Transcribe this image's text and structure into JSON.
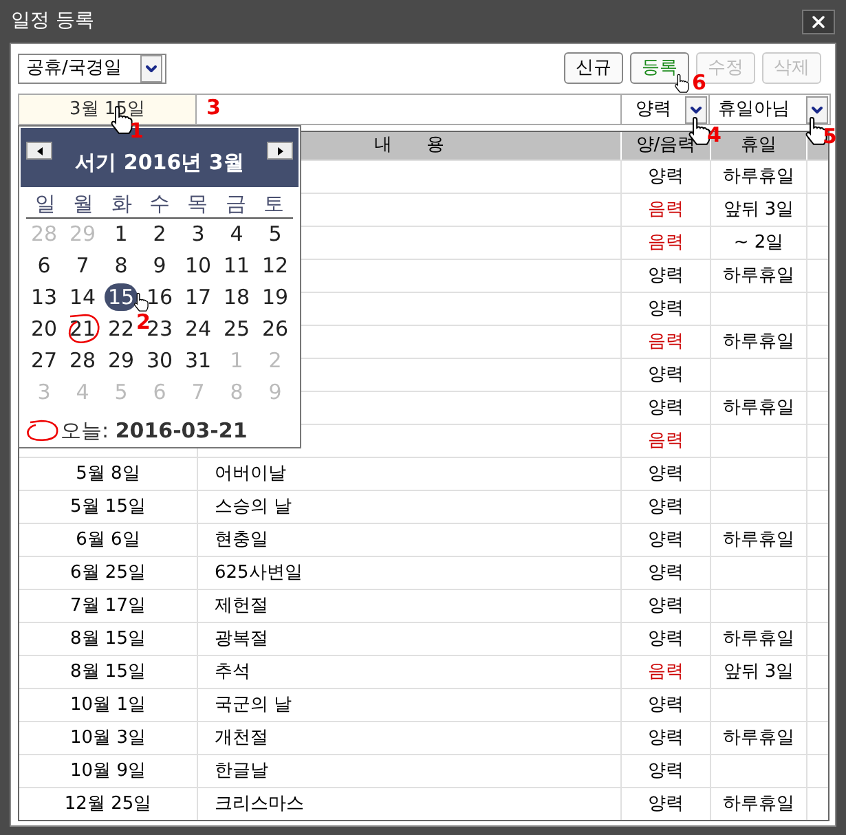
{
  "window": {
    "title": "일정 등록"
  },
  "toolbar": {
    "category": "공휴/국경일",
    "buttons": [
      {
        "label": "신규",
        "disabled": false,
        "highlighted": false
      },
      {
        "label": "등록",
        "disabled": false,
        "highlighted": true
      },
      {
        "label": "수정",
        "disabled": true,
        "highlighted": false
      },
      {
        "label": "삭제",
        "disabled": true,
        "highlighted": false
      }
    ]
  },
  "form": {
    "date": "3월 15일",
    "calendar_type": "양력",
    "holiday": "휴일아님"
  },
  "table": {
    "columns": [
      "내      용",
      "양/음력",
      "휴일"
    ],
    "rows": [
      {
        "calendar": "양력",
        "lunar": false,
        "holiday": "하루휴일"
      },
      {
        "calendar": "음력",
        "lunar": true,
        "holiday": "앞뒤 3일"
      },
      {
        "calendar": "음력",
        "lunar": true,
        "holiday": "~ 2일"
      },
      {
        "calendar": "양력",
        "lunar": false,
        "holiday": "하루휴일"
      },
      {
        "calendar": "양력",
        "lunar": false
      },
      {
        "calendar": "음력",
        "lunar": true,
        "holiday": "하루휴일"
      },
      {
        "calendar": "양력",
        "lunar": false
      },
      {
        "calendar": "양력",
        "lunar": false,
        "holiday": "하루휴일"
      },
      {
        "calendar": "음력",
        "lunar": true
      },
      {
        "date": "5월 8일",
        "name": "어버이날",
        "calendar": "양력",
        "lunar": false
      },
      {
        "date": "5월 15일",
        "name": "스승의 날",
        "calendar": "양력",
        "lunar": false
      },
      {
        "date": "6월 6일",
        "name": "현충일",
        "calendar": "양력",
        "lunar": false,
        "holiday": "하루휴일"
      },
      {
        "date": "6월 25일",
        "name": "625사변일",
        "calendar": "양력",
        "lunar": false
      },
      {
        "date": "7월 17일",
        "name": "제헌절",
        "calendar": "양력",
        "lunar": false
      },
      {
        "date": "8월 15일",
        "name": "광복절",
        "calendar": "양력",
        "lunar": false,
        "holiday": "하루휴일"
      },
      {
        "date": "8월 15일",
        "name": "추석",
        "calendar": "음력",
        "lunar": true,
        "holiday": "앞뒤 3일"
      },
      {
        "date": "10월 1일",
        "name": "국군의 날",
        "calendar": "양력",
        "lunar": false
      },
      {
        "date": "10월 3일",
        "name": "개천절",
        "calendar": "양력",
        "lunar": false,
        "holiday": "하루휴일"
      },
      {
        "date": "10월 9일",
        "name": "한글날",
        "calendar": "양력",
        "lunar": false
      },
      {
        "date": "12월 25일",
        "name": "크리스마스",
        "calendar": "양력",
        "lunar": false,
        "holiday": "하루휴일"
      }
    ]
  },
  "date_picker": {
    "title": "서기 2016년 3월",
    "weekdays": [
      "일",
      "월",
      "화",
      "수",
      "목",
      "금",
      "토"
    ],
    "weeks": [
      [
        {
          "d": "28",
          "muted": true,
          "selected": false,
          "circled": false
        },
        {
          "d": "29",
          "muted": true,
          "selected": false,
          "circled": false
        },
        {
          "d": "1",
          "muted": false,
          "selected": false,
          "circled": false
        },
        {
          "d": "2",
          "muted": false,
          "selected": false,
          "circled": false
        },
        {
          "d": "3",
          "muted": false,
          "selected": false,
          "circled": false
        },
        {
          "d": "4",
          "muted": false,
          "selected": false,
          "circled": false
        },
        {
          "d": "5",
          "muted": false,
          "selected": false,
          "circled": false
        }
      ],
      [
        {
          "d": "6",
          "muted": false,
          "selected": false,
          "circled": false
        },
        {
          "d": "7",
          "muted": false,
          "selected": false,
          "circled": false
        },
        {
          "d": "8",
          "muted": false,
          "selected": false,
          "circled": false
        },
        {
          "d": "9",
          "muted": false,
          "selected": false,
          "circled": false
        },
        {
          "d": "10",
          "muted": false,
          "selected": false,
          "circled": false
        },
        {
          "d": "11",
          "muted": false,
          "selected": false,
          "circled": false
        },
        {
          "d": "12",
          "muted": false,
          "selected": false,
          "circled": false
        }
      ],
      [
        {
          "d": "13",
          "muted": false,
          "selected": false,
          "circled": false
        },
        {
          "d": "14",
          "muted": false,
          "selected": false,
          "circled": false
        },
        {
          "d": "15",
          "muted": false,
          "selected": true,
          "circled": false
        },
        {
          "d": "16",
          "muted": false,
          "selected": false,
          "circled": false
        },
        {
          "d": "17",
          "muted": false,
          "selected": false,
          "circled": false
        },
        {
          "d": "18",
          "muted": false,
          "selected": false,
          "circled": false
        },
        {
          "d": "19",
          "muted": false,
          "selected": false,
          "circled": false
        }
      ],
      [
        {
          "d": "20",
          "muted": false,
          "selected": false,
          "circled": false
        },
        {
          "d": "21",
          "muted": false,
          "selected": false,
          "circled": true
        },
        {
          "d": "22",
          "muted": false,
          "selected": false,
          "circled": false
        },
        {
          "d": "23",
          "muted": false,
          "selected": false,
          "circled": false
        },
        {
          "d": "24",
          "muted": false,
          "selected": false,
          "circled": false
        },
        {
          "d": "25",
          "muted": false,
          "selected": false,
          "circled": false
        },
        {
          "d": "26",
          "muted": false,
          "selected": false,
          "circled": false
        }
      ],
      [
        {
          "d": "27",
          "muted": false,
          "selected": false,
          "circled": false
        },
        {
          "d": "28",
          "muted": false,
          "selected": false,
          "circled": false
        },
        {
          "d": "29",
          "muted": false,
          "selected": false,
          "circled": false
        },
        {
          "d": "30",
          "muted": false,
          "selected": false,
          "circled": false
        },
        {
          "d": "31",
          "muted": false,
          "selected": false,
          "circled": false
        },
        {
          "d": "1",
          "muted": true,
          "selected": false,
          "circled": false
        },
        {
          "d": "2",
          "muted": true,
          "selected": false,
          "circled": false
        }
      ],
      [
        {
          "d": "3",
          "muted": true,
          "selected": false,
          "circled": false
        },
        {
          "d": "4",
          "muted": true,
          "selected": false,
          "circled": false
        },
        {
          "d": "5",
          "muted": true,
          "selected": false,
          "circled": false
        },
        {
          "d": "6",
          "muted": true,
          "selected": false,
          "circled": false
        },
        {
          "d": "7",
          "muted": true,
          "selected": false,
          "circled": false
        },
        {
          "d": "8",
          "muted": true,
          "selected": false,
          "circled": false
        },
        {
          "d": "9",
          "muted": true,
          "selected": false,
          "circled": false
        }
      ]
    ],
    "today": "오늘: **2016-03-21**"
  },
  "annotations": [
    "1",
    "2",
    "3",
    "4",
    "5",
    "6"
  ]
}
